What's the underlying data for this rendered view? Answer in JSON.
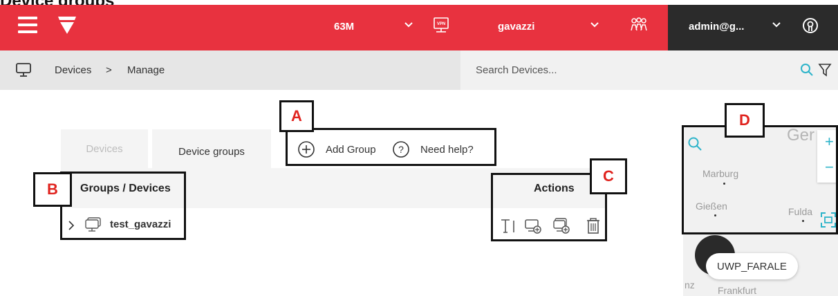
{
  "page_heading": "Device groups",
  "header": {
    "account": "63M",
    "company": "gavazzi",
    "user": "admin@g...",
    "vpn_label": "VPN"
  },
  "breadcrumb": {
    "root": "Devices",
    "separator": ">",
    "current": "Manage"
  },
  "search": {
    "placeholder": "Search Devices..."
  },
  "tabs": [
    {
      "label": "Devices",
      "active": false
    },
    {
      "label": "Device groups",
      "active": true
    }
  ],
  "toolbar": {
    "add_group": "Add Group",
    "need_help": "Need help?"
  },
  "table": {
    "columns": [
      "Groups / Devices",
      "Actions"
    ],
    "rows": [
      {
        "name": "test_gavazzi",
        "actions": [
          "rename-icon",
          "add-device-icon",
          "add-device-alt-icon",
          "delete-icon"
        ]
      }
    ]
  },
  "map": {
    "towns": [
      "Ger",
      "Marburg",
      "Gießen",
      "Fulda",
      "Frankfurt",
      "nz"
    ],
    "marker_label": "UWP_FARALE",
    "controls": [
      "+",
      "−"
    ]
  },
  "annotations": [
    "A",
    "B",
    "C",
    "D"
  ],
  "colors": {
    "brand_red": "#e8323f",
    "header_dark": "#2b2b2b",
    "accent_teal": "#2bb3c9",
    "annotation_red": "#e0241f"
  }
}
